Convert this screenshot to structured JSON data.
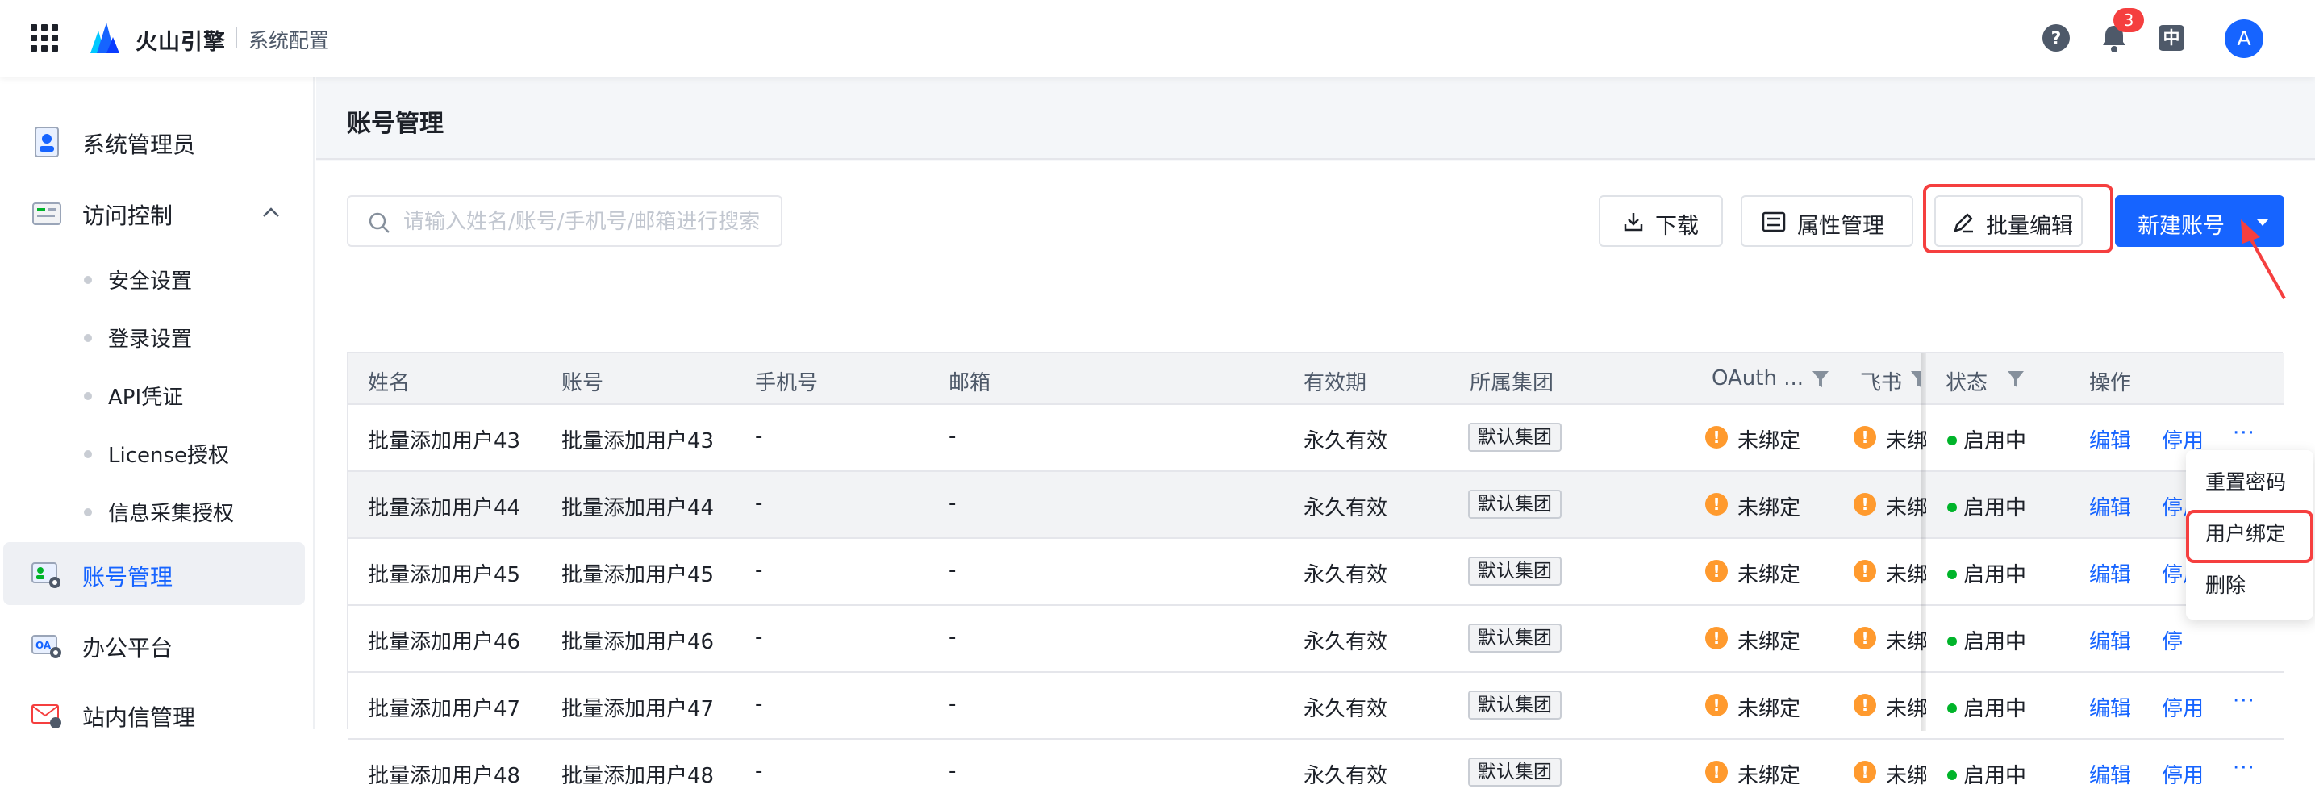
{
  "topbar": {
    "brand": "火山引擎",
    "subtitle": "系统配置",
    "notification_count": "3",
    "lang_label": "中",
    "avatar_letter": "A",
    "icons": [
      "apps-grid-icon",
      "volcano-logo-icon",
      "help-icon",
      "bell-icon",
      "language-icon"
    ]
  },
  "sidebar": {
    "items": [
      {
        "label": "系统管理员",
        "icon": "admin-icon"
      },
      {
        "label": "访问控制",
        "icon": "access-control-icon",
        "expanded": true
      },
      {
        "label": "账号管理",
        "icon": "account-icon",
        "active": true
      },
      {
        "label": "办公平台",
        "icon": "oa-icon"
      },
      {
        "label": "站内信管理",
        "icon": "mail-icon"
      }
    ],
    "sub_items": [
      "安全设置",
      "登录设置",
      "API凭证",
      "License授权",
      "信息采集授权"
    ]
  },
  "page": {
    "title": "账号管理"
  },
  "toolbar": {
    "search_placeholder": "请输入姓名/账号/手机号/邮箱进行搜索",
    "download_label": "下载",
    "attr_label": "属性管理",
    "batch_edit_label": "批量编辑",
    "new_account_label": "新建账号"
  },
  "table": {
    "columns": [
      "姓名",
      "账号",
      "手机号",
      "邮箱",
      "有效期",
      "所属集团",
      "OAuth ...",
      "飞书",
      "状态",
      "操作"
    ],
    "rows": [
      {
        "name": "批量添加用户43",
        "account": "批量添加用户43",
        "phone": "-",
        "email": "-",
        "validity": "永久有效",
        "group": "默认集团",
        "oauth": "未绑定",
        "feishu": "未绑",
        "status": "启用中"
      },
      {
        "name": "批量添加用户44",
        "account": "批量添加用户44",
        "phone": "-",
        "email": "-",
        "validity": "永久有效",
        "group": "默认集团",
        "oauth": "未绑定",
        "feishu": "未绑",
        "status": "启用中"
      },
      {
        "name": "批量添加用户45",
        "account": "批量添加用户45",
        "phone": "-",
        "email": "-",
        "validity": "永久有效",
        "group": "默认集团",
        "oauth": "未绑定",
        "feishu": "未绑",
        "status": "启用中"
      },
      {
        "name": "批量添加用户46",
        "account": "批量添加用户46",
        "phone": "-",
        "email": "-",
        "validity": "永久有效",
        "group": "默认集团",
        "oauth": "未绑定",
        "feishu": "未绑",
        "status": "启用中"
      },
      {
        "name": "批量添加用户47",
        "account": "批量添加用户47",
        "phone": "-",
        "email": "-",
        "validity": "永久有效",
        "group": "默认集团",
        "oauth": "未绑定",
        "feishu": "未绑",
        "status": "启用中"
      },
      {
        "name": "批量添加用户48",
        "account": "批量添加用户48",
        "phone": "-",
        "email": "-",
        "validity": "永久有效",
        "group": "默认集团",
        "oauth": "未绑定",
        "feishu": "未绑",
        "status": "启用中"
      }
    ],
    "action_edit": "编辑",
    "action_disable": "停用",
    "action_disable_partial": "停",
    "action_more": "···",
    "warn_symbol": "!"
  },
  "dropdown": {
    "items": [
      "重置密码",
      "用户绑定",
      "删除"
    ]
  },
  "colors": {
    "accent": "#1664ff",
    "highlight": "#f53f3f",
    "warning": "#ff9a2e",
    "success": "#00b42a"
  }
}
